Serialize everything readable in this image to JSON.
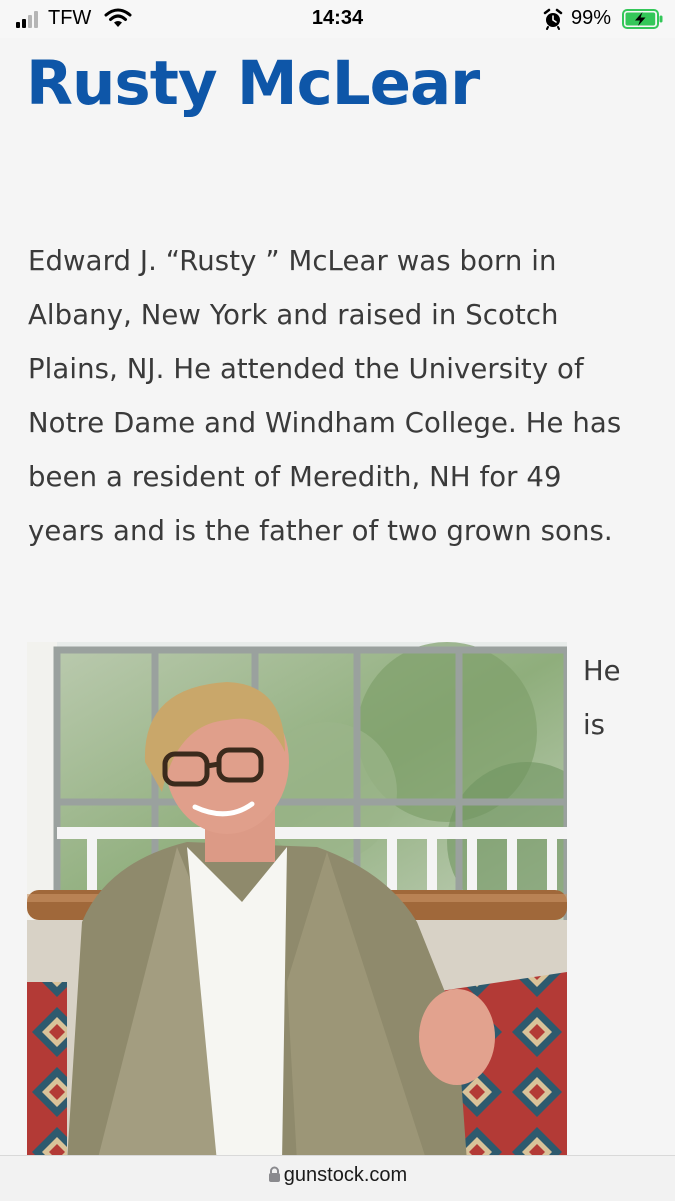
{
  "status_bar": {
    "carrier": "TFW",
    "time": "14:34",
    "battery_percent": "99%",
    "battery_level": 0.99,
    "battery_color": "#34c759",
    "icons": [
      "signal-icon",
      "wifi-icon",
      "alarm-icon",
      "battery-charging-icon"
    ]
  },
  "page": {
    "title": "Rusty McLear",
    "title_color": "#0e56a8",
    "bio": "Edward J. “Rusty ” McLear was born in Albany, New York and raised in Scotch Plains, NJ. He attended the University of Notre Dame and Windham College. He has been a resident of Meredith, NH for 49 years and is the father of two grown sons.",
    "wrap_word_1": "He",
    "wrap_word_2": "is"
  },
  "url_bar": {
    "domain": "gunstock.com",
    "icons": [
      "lock-icon"
    ]
  }
}
